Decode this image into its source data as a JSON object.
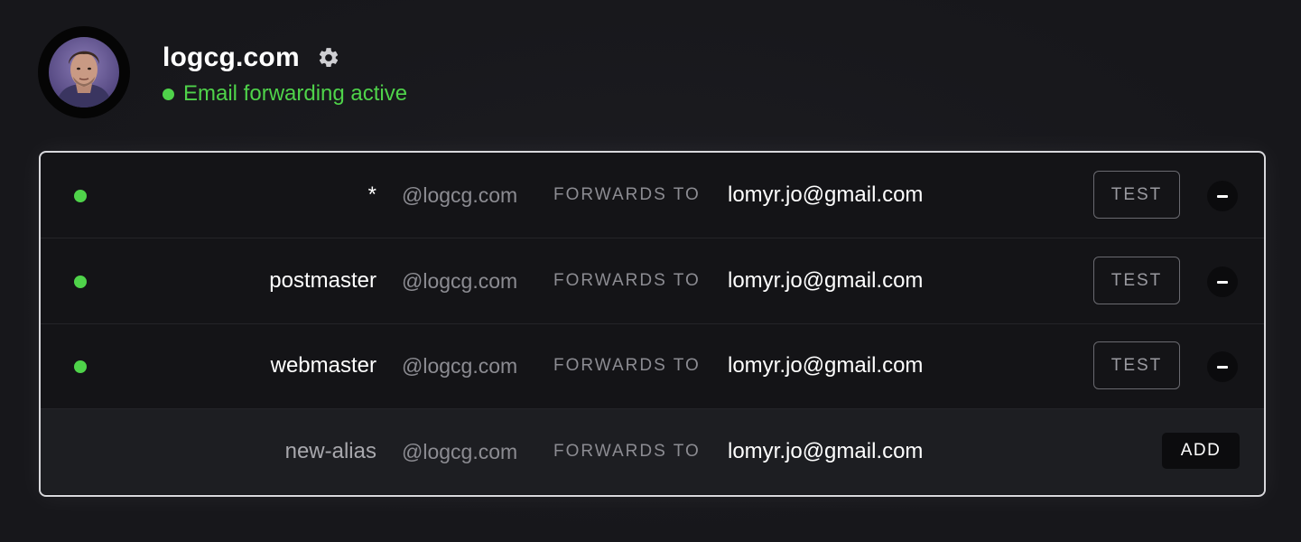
{
  "header": {
    "domain": "logcg.com",
    "status_text": "Email forwarding active",
    "status_color": "#4fd34a",
    "settings_icon": "gear-icon",
    "avatar_icon": "user-avatar"
  },
  "table": {
    "rows": [
      {
        "alias": "*",
        "domain_suffix": "@logcg.com",
        "forwards_label": "FORWARDS TO",
        "destination": "lomyr.jo@gmail.com",
        "test_label": "TEST",
        "remove_icon": "minus-icon",
        "active": true
      },
      {
        "alias": "postmaster",
        "domain_suffix": "@logcg.com",
        "forwards_label": "FORWARDS TO",
        "destination": "lomyr.jo@gmail.com",
        "test_label": "TEST",
        "remove_icon": "minus-icon",
        "active": true
      },
      {
        "alias": "webmaster",
        "domain_suffix": "@logcg.com",
        "forwards_label": "FORWARDS TO",
        "destination": "lomyr.jo@gmail.com",
        "test_label": "TEST",
        "remove_icon": "minus-icon",
        "active": true
      }
    ],
    "new_row": {
      "alias_placeholder": "new-alias",
      "domain_suffix": "@logcg.com",
      "forwards_label": "FORWARDS TO",
      "destination": "lomyr.jo@gmail.com",
      "add_label": "ADD"
    }
  }
}
